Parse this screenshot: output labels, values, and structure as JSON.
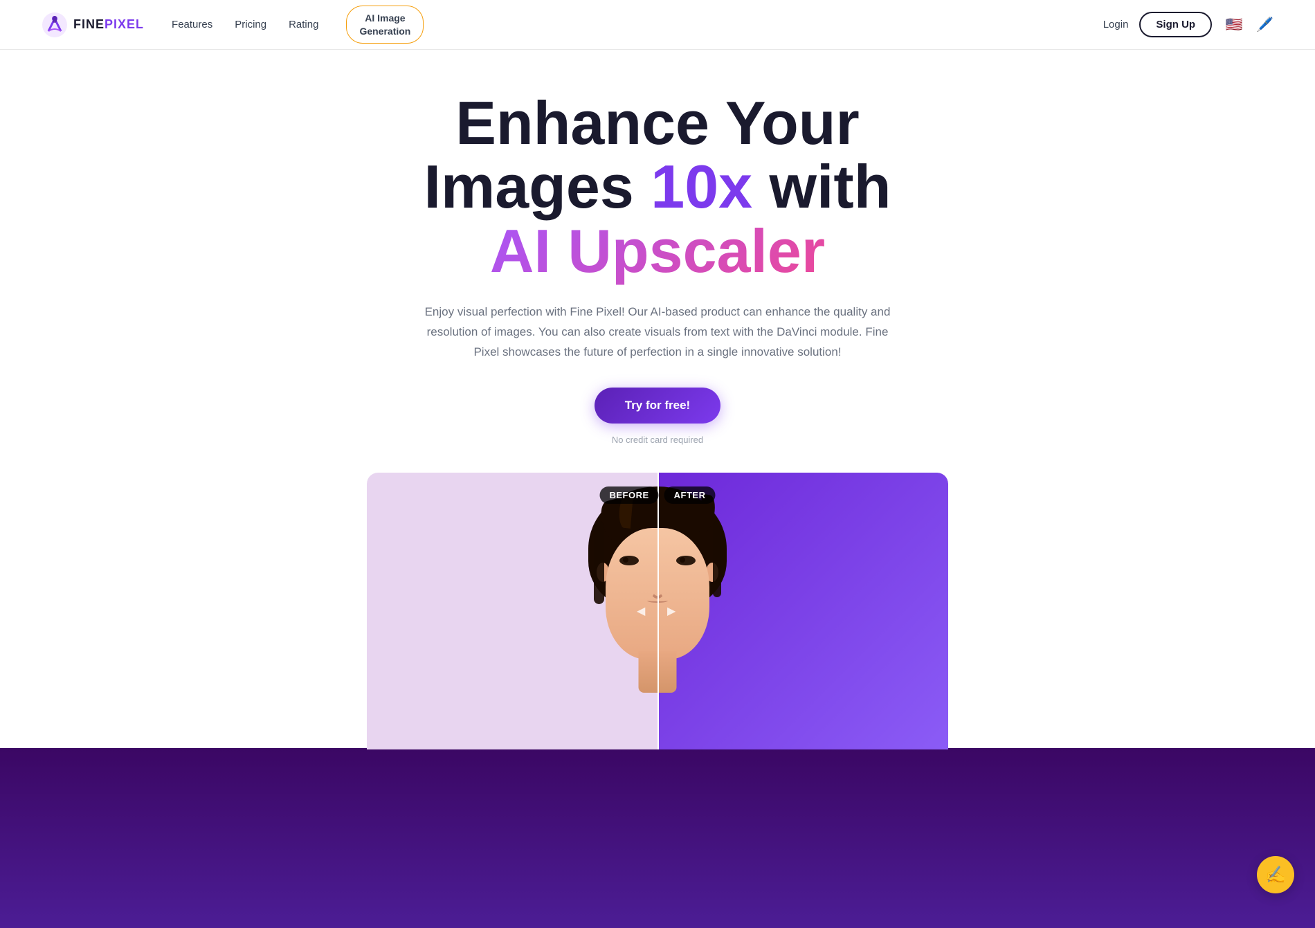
{
  "nav": {
    "logo_text_main": "FINE",
    "logo_text_accent": "PIXEL",
    "links": [
      {
        "label": "Features",
        "id": "features"
      },
      {
        "label": "Pricing",
        "id": "pricing"
      },
      {
        "label": "Rating",
        "id": "rating"
      }
    ],
    "ai_button_line1": "AI Image",
    "ai_button_line2": "Generation",
    "login_label": "Login",
    "signup_label": "Sign Up"
  },
  "hero": {
    "title_line1": "Enhance Your",
    "title_line2_normal": "Images ",
    "title_line2_highlight": "10x",
    "title_line2_normal2": " with",
    "title_line3": "AI Upscaler",
    "subtitle": "Enjoy visual perfection with Fine Pixel! Our AI-based product can enhance the quality and resolution of images. You can also create visuals from text with the DaVinci module. Fine Pixel showcases the future of perfection in a single innovative solution!",
    "cta_button": "Try for free!",
    "no_credit": "No credit card required"
  },
  "comparison": {
    "before_label": "BEFORE",
    "after_label": "AFTER"
  },
  "chat": {
    "icon": "✍️"
  },
  "colors": {
    "purple_dark": "#3b0764",
    "purple_mid": "#7c3aed",
    "purple_light": "#a855f7",
    "pink": "#ec4899",
    "amber": "#f59e0b",
    "dark": "#1a1a2e",
    "gray": "#6b7280"
  }
}
